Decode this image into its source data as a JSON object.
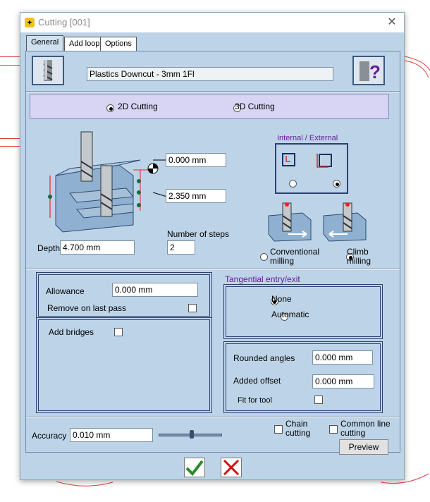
{
  "window": {
    "title": "Cutting [001]",
    "app_icon": "app-icon",
    "close_glyph": "✕"
  },
  "tabs": [
    {
      "label": "General",
      "active": true
    },
    {
      "label": "Add loop",
      "active": false
    },
    {
      "label": "Options",
      "active": false
    }
  ],
  "tool": {
    "name": "Plastics Downcut - 3mm 1Fl"
  },
  "mode": {
    "option_2d": "2D Cutting",
    "option_3d": "3D Cutting",
    "selected": "2D Cutting"
  },
  "geometry": {
    "top_offset": "0.000 mm",
    "step_height": "2.350 mm",
    "depth_label": "Depth",
    "depth": "4.700 mm",
    "steps_label": "Number of steps",
    "steps": "2"
  },
  "internal_external": {
    "title": "Internal / External",
    "selected": "external"
  },
  "milling": {
    "conventional": "Conventional milling",
    "conv_line1": "Conventional",
    "conv_line2": "milling",
    "climb_line1": "Climb",
    "climb_line2": "milling",
    "selected": "climb"
  },
  "allowance": {
    "label": "Allowance",
    "value": "0.000 mm",
    "remove_label": "Remove on last pass",
    "remove_checked": false
  },
  "bridges": {
    "label": "Add bridges",
    "checked": false
  },
  "tangential": {
    "title": "Tangential entry/exit",
    "none": "None",
    "automatic": "Automatic",
    "selected": "None"
  },
  "corners": {
    "rounded_label": "Rounded angles",
    "rounded_value": "0.000 mm",
    "offset_label": "Added offset",
    "offset_value": "0.000 mm",
    "fit_label": "Fit for tool",
    "fit_checked": false
  },
  "accuracy": {
    "label": "Accuracy",
    "value": "0.010 mm",
    "slider_fraction": 0.52
  },
  "chain": {
    "line1": "Chain",
    "line2": "cutting",
    "checked": false
  },
  "common": {
    "line1": "Common line",
    "line2": "cutting",
    "checked": false
  },
  "preview_label": "Preview",
  "colors": {
    "ok": "#2a8a2a",
    "cancel": "#cc1111",
    "accent": "#6a1a9a"
  }
}
